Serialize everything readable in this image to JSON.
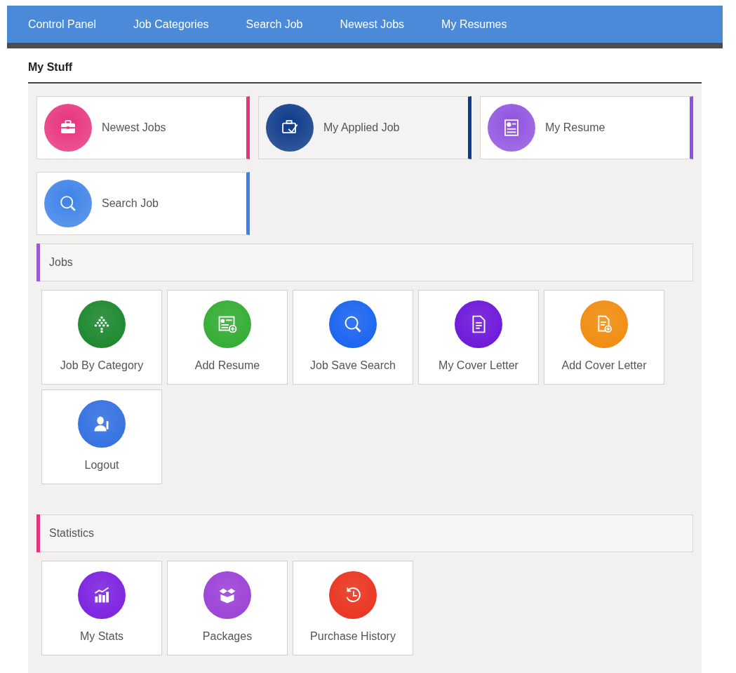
{
  "nav": {
    "items": [
      {
        "label": "Control Panel"
      },
      {
        "label": "Job Categories"
      },
      {
        "label": "Search Job"
      },
      {
        "label": "Newest Jobs"
      },
      {
        "label": "My Resumes"
      }
    ]
  },
  "heading": "My Stuff",
  "quick_links": [
    {
      "label": "Newest Jobs",
      "color": "#e8337f",
      "selected": false
    },
    {
      "label": "My Applied Job",
      "color": "#0d3a8a",
      "selected": true
    },
    {
      "label": "My Resume",
      "color": "#8f52e0",
      "selected": false
    },
    {
      "label": "Search Job",
      "color": "#3d82e8",
      "selected": false
    }
  ],
  "sections": [
    {
      "title": "Jobs",
      "color": "#9b59d6",
      "tiles": [
        {
          "label": "Job By Category",
          "color": "#17852a"
        },
        {
          "label": "Add Resume",
          "color": "#2eab2e"
        },
        {
          "label": "Job Save Search",
          "color": "#1560f0"
        },
        {
          "label": "My Cover Letter",
          "color": "#6a12d8"
        },
        {
          "label": "Add Cover Letter",
          "color": "#f08a0a"
        },
        {
          "label": "Logout",
          "color": "#2f6ee0"
        }
      ]
    },
    {
      "title": "Statistics",
      "color": "#e8337f",
      "tiles": [
        {
          "label": "My Stats",
          "color": "#7a1ee0"
        },
        {
          "label": "Packages",
          "color": "#9a3ed6"
        },
        {
          "label": "Purchase History",
          "color": "#e8301a"
        }
      ]
    }
  ]
}
